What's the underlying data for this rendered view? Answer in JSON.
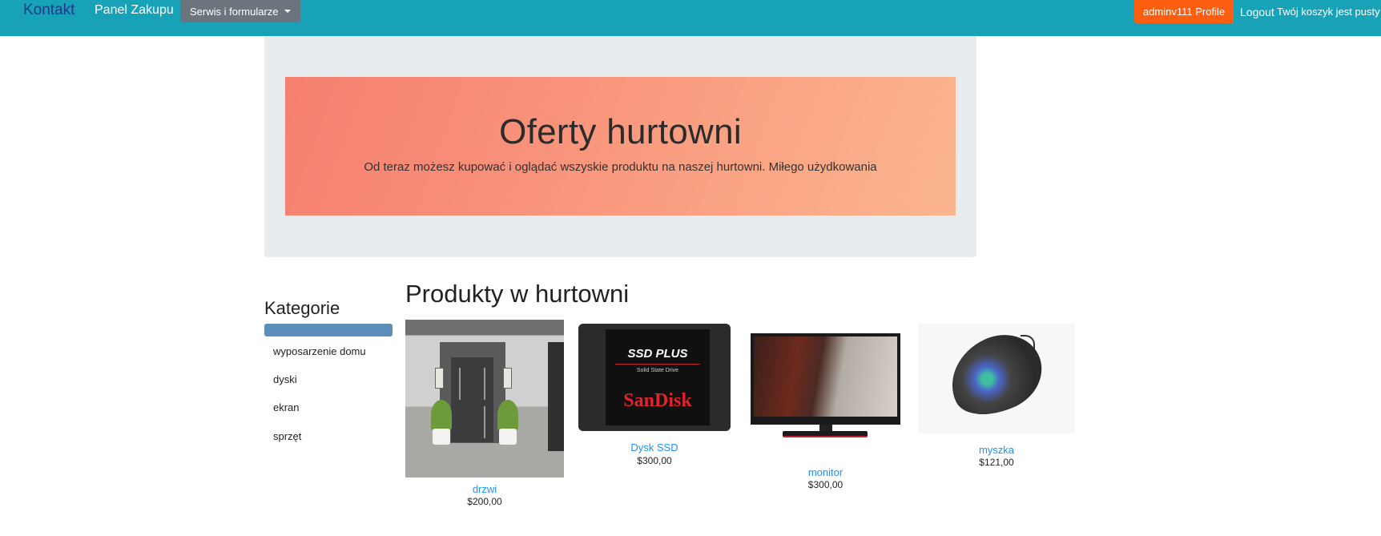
{
  "navbar": {
    "brand": "Kontakt",
    "panel_link": "Panel Zakupu",
    "dropdown_label": "Serwis i formularze",
    "profile_button": "adminv111 Profile",
    "logout": "Logout",
    "cart_status": "Twój koszyk jest pusty",
    "colors": {
      "navbar_bg": "#17a2b8",
      "profile_bg": "#fd5e0f",
      "dropdown_bg": "#6c757d"
    }
  },
  "hero": {
    "title": "Oferty hurtowni",
    "subtitle": "Od teraz możesz kupować i oglądać wszyskie produktu na naszej hurtowni. Miłego użydkowania"
  },
  "sidebar": {
    "heading": "Kategorie",
    "categories": [
      "wyposarzenie domu",
      "dyski",
      "ekran",
      "sprzęt"
    ]
  },
  "products": {
    "heading": "Produkty w hurtowni",
    "items": [
      {
        "name": "drzwi",
        "price": "$200,00",
        "image": "door-image"
      },
      {
        "name": "Dysk SSD",
        "price": "$300,00",
        "image": "ssd-image",
        "image_text": {
          "line1": "SanDisk",
          "line2": "SSD PLUS",
          "line3": "Solid State Drive",
          "brand": "SanDisk"
        }
      },
      {
        "name": "monitor",
        "price": "$300,00",
        "image": "monitor-image"
      },
      {
        "name": "myszka",
        "price": "$121,00",
        "image": "mouse-image"
      }
    ]
  }
}
